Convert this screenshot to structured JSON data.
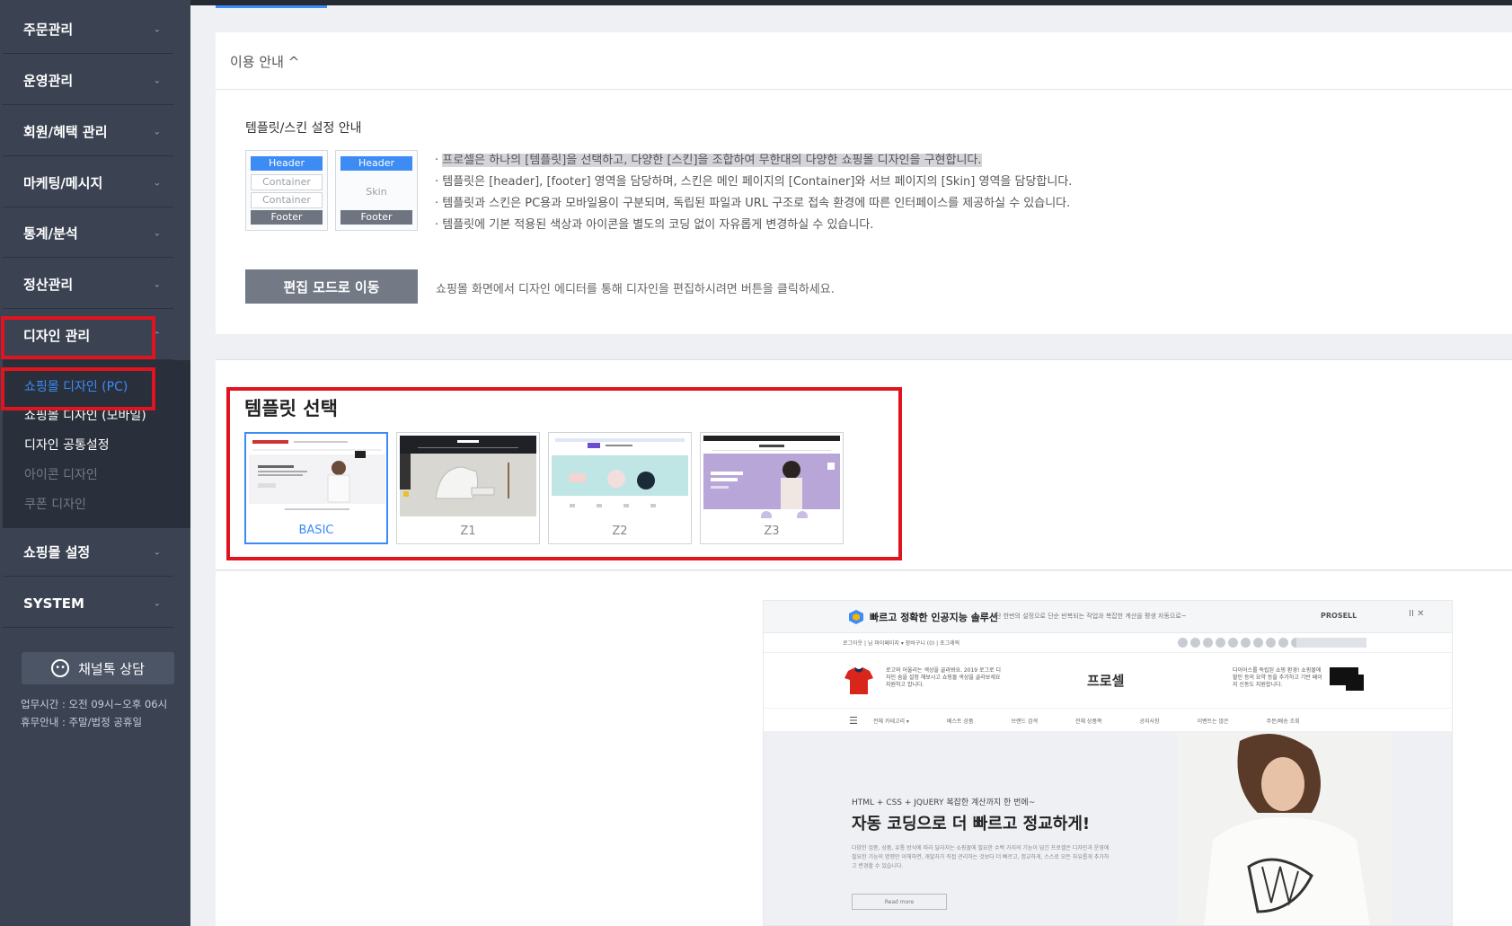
{
  "sidebar": {
    "items": [
      {
        "label": "주문관리"
      },
      {
        "label": "운영관리"
      },
      {
        "label": "회원/혜택 관리"
      },
      {
        "label": "마케팅/메시지"
      },
      {
        "label": "통계/분석"
      },
      {
        "label": "정산관리"
      },
      {
        "label": "디자인 관리"
      }
    ],
    "design_submenu": [
      {
        "label": "쇼핑몰 디자인 (PC)",
        "active": true
      },
      {
        "label": "쇼핑몰 디자인 (모바일)"
      },
      {
        "label": "디자인 공통설정"
      },
      {
        "label": "아이콘 디자인"
      },
      {
        "label": "쿠폰 디자인"
      }
    ],
    "bottom_items": [
      {
        "label": "쇼핑몰 설정"
      },
      {
        "label": "SYSTEM"
      }
    ],
    "chat_button": "채널톡 상담",
    "hours": "업무시간 : 오전 09시~오후 06시",
    "holiday": "휴무안내 : 주말/법정 공휴일"
  },
  "usage": {
    "toggle_label": "이용 안내 ^",
    "guide_title": "템플릿/스킨 설정 안내",
    "diagram_template": {
      "header": "Header",
      "container1": "Container",
      "container2": "Container",
      "footer": "Footer"
    },
    "diagram_skin": {
      "header": "Header",
      "skin": "Skin",
      "footer": "Footer"
    },
    "bullets": [
      "프로셀은 하나의 [템플릿]을 선택하고, 다양한 [스킨]을 조합하여 무한대의 다양한 쇼핑몰 디자인을 구현합니다.",
      "템플릿은 [header], [footer] 영역을 담당하며, 스킨은 메인 페이지의 [Container]와 서브 페이지의 [Skin] 영역을 담당합니다.",
      "템플릿과 스킨은 PC용과 모바일용이 구분되며, 독립된 파일과 URL 구조로 접속 환경에 따른 인터페이스를 제공하실 수 있습니다.",
      "템플릿에 기본 적용된 색상과 아이콘을 별도의 코딩 없이 자유롭게 변경하실 수 있습니다."
    ],
    "edit_button": "편집 모드로 이동",
    "edit_desc": "쇼핑몰 화면에서 디자인 에디터를 통해 디자인을 편집하시려면 버튼을 클릭하세요."
  },
  "templates": {
    "title": "템플릿 선택",
    "items": [
      {
        "label": "BASIC",
        "selected": true
      },
      {
        "label": "Z1"
      },
      {
        "label": "Z2"
      },
      {
        "label": "Z3"
      }
    ]
  },
  "preview": {
    "banner_title": "빠르고 정확한 인공지능 솔루션",
    "banner_sub": "단 한번의 설정으로 단순 반복되는 작업과 복잡한 계산을 평생 자동으로~",
    "banner_brand": "PROSELL",
    "banner_controls": "II  ✕",
    "util_links": "로그아웃 | 님    마이페이지 ▾    장바구니 (0)    |    포그래픽",
    "header_logo": "프로셀",
    "header_left": "로고와 어울리는 색상을 골라봐요. 2019 로그로 디자인 숨을 설정 해보시고 쇼핑몰 색상을 골라보세요 지원하고 합니다.",
    "header_right": "다이어스를 독립된 쇼핑 환경! 쇼핑몰에 할인 등의 요약 등을 추가하고 기반 페이지 신동도 지원합니다.",
    "nav_items": [
      "전체 카테고리 ▾",
      "베스트 상품",
      "브랜드 검색",
      "전체 상품쪽",
      "공지사항",
      "이벤트는 많은",
      "주문/배송 조회"
    ],
    "hero_small": "HTML + CSS + JQUERY 복잡한 계산까지 한 번에~",
    "hero_big": "자동 코딩으로 더 빠르고 정교하게!",
    "hero_desc": "다양한 업종, 상품, 유통 방식에 따라 달라지는 쇼핑몰에 필요한 수백 가지의 기능이 담긴 프로셀은 디자인과 운영에 필요한 기능의 명령만 이해하면, 개발자가 직접 관리하는 것보다 더 빠르고, 정교하게, 스스로 모든 자유롭게 추가하고 변경할 수 있습니다.",
    "hero_button": "Read more"
  },
  "colors": {
    "accent": "#3d8bf5",
    "highlight_box": "#e0141e",
    "sidebar_bg": "#3b4352"
  }
}
